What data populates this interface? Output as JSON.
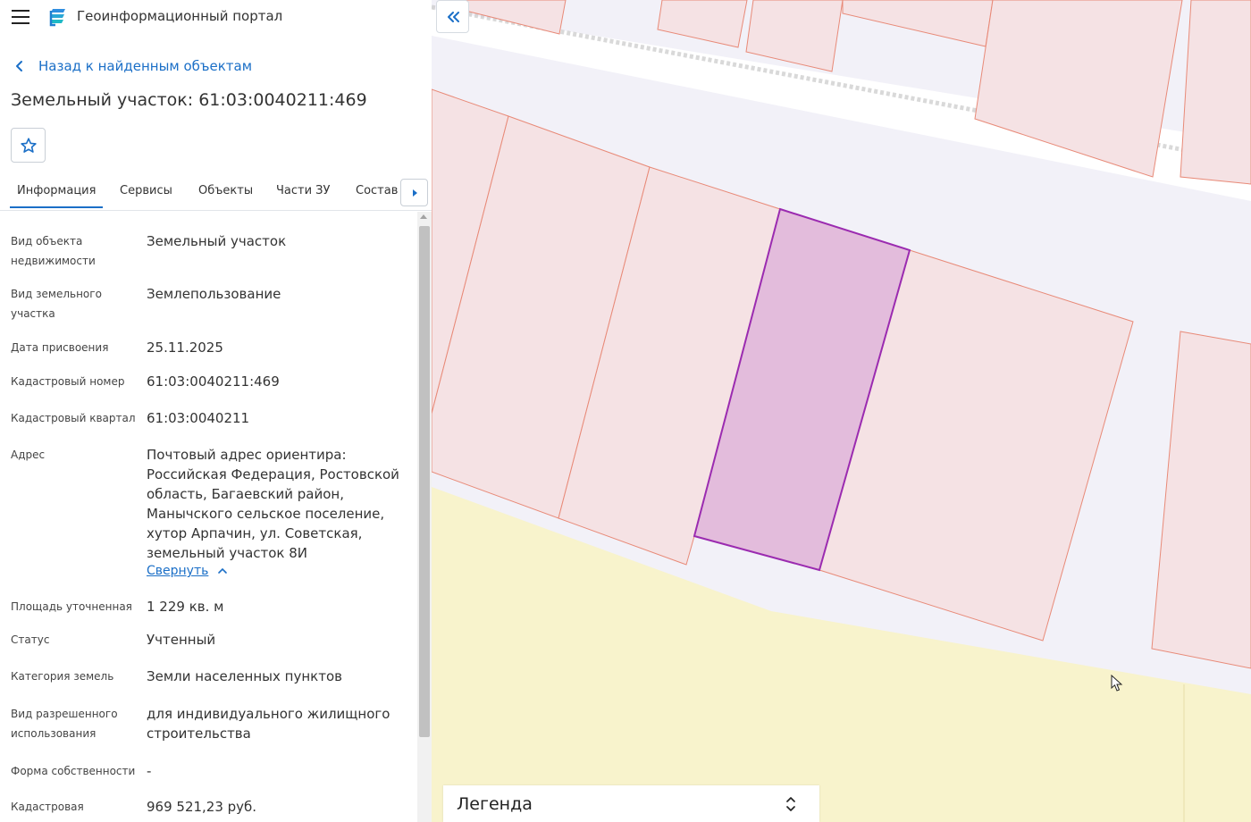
{
  "app": {
    "title": "Геоинформационный портал"
  },
  "nav": {
    "back_label": "Назад к найденным объектам"
  },
  "object": {
    "title": "Земельный участок: 61:03:0040211:469"
  },
  "tabs": [
    {
      "label": "Информация",
      "active": true
    },
    {
      "label": "Сервисы",
      "active": false
    },
    {
      "label": "Объекты",
      "active": false
    },
    {
      "label": "Части ЗУ",
      "active": false
    },
    {
      "label": "Состав",
      "active": false
    }
  ],
  "attributes": [
    {
      "label": "Вид объекта недвижимости",
      "value": "Земельный участок"
    },
    {
      "label": "Вид земельного участка",
      "value": "Землепользование"
    },
    {
      "label": "Дата присвоения",
      "value": "25.11.2025"
    },
    {
      "label": "Кадастровый номер",
      "value": "61:03:0040211:469"
    },
    {
      "label": "Кадастровый квартал",
      "value": "61:03:0040211"
    },
    {
      "label": "Адрес",
      "value": "Почтовый адрес ориентира: Российская Федерация, Ростовской область, Багаевский район, Манычского сельское поселение, хутор Арпачин, ул. Советская, земельный участок 8И"
    },
    {
      "label": "Площадь уточненная",
      "value": "1 229 кв. м"
    },
    {
      "label": "Статус",
      "value": "Учтенный"
    },
    {
      "label": "Категория земель",
      "value": "Земли населенных пунктов"
    },
    {
      "label": "Вид разрешенного использования",
      "value": "для индивидуального жилищного строительства"
    },
    {
      "label": "Форма собственности",
      "value": "-"
    },
    {
      "label": "Кадастровая",
      "value": "969 521,23 руб."
    }
  ],
  "address_toggle": {
    "label": "Свернуть"
  },
  "legend": {
    "label": "Легенда"
  },
  "colors": {
    "accent": "#1b6fc7",
    "parcel_fill": "#f5e2e4",
    "parcel_stroke": "#e88a78",
    "selected_fill": "#e3bcdc",
    "selected_stroke": "#9b2bb0",
    "zone_fill": "#f8f3cc"
  },
  "icons": {
    "menu": "menu-icon",
    "logo": "portal-logo-icon",
    "back": "chevron-left-icon",
    "favorite": "star-icon",
    "tabs_scroll": "caret-right-icon",
    "collapse_panel": "double-chevron-left-icon",
    "legend_toggle": "chevron-up-down-icon"
  }
}
